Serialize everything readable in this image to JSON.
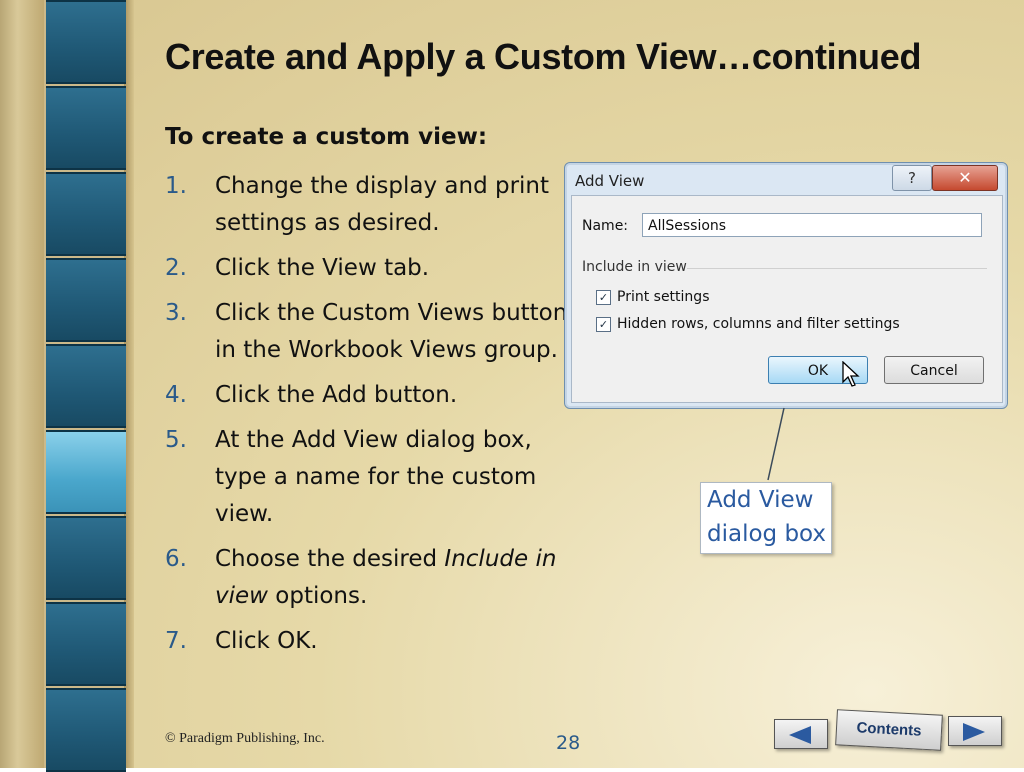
{
  "slide": {
    "title": "Create and Apply a Custom View…continued",
    "subheading": "To create a custom view:",
    "steps": [
      {
        "num": "1.",
        "text": "Change the display and print settings as desired."
      },
      {
        "num": "2.",
        "text": "Click the View tab."
      },
      {
        "num": "3.",
        "text": "Click the Custom Views button in the Workbook Views group."
      },
      {
        "num": "4.",
        "text": "Click the Add button."
      },
      {
        "num": "5.",
        "text": "At the Add View dialog box, type a name for the custom view."
      },
      {
        "num": "6.",
        "text_before": "Choose the desired ",
        "text_italic": "Include in view",
        "text_after": " options."
      },
      {
        "num": "7.",
        "text": "Click OK."
      }
    ],
    "callout": {
      "line1": "Add View",
      "line2": "dialog box"
    },
    "footer": "© Paradigm Publishing, Inc.",
    "page_number": "28",
    "nav": {
      "contents_label": "Contents",
      "prev_icon": "left-arrow-icon",
      "next_icon": "right-arrow-icon"
    }
  },
  "dialog": {
    "title": "Add View",
    "help_glyph": "?",
    "close_glyph": "✕",
    "name_label": "Name:",
    "name_value": "AllSessions",
    "group_label": "Include in view",
    "checkboxes": [
      {
        "label": "Print settings",
        "checked": true
      },
      {
        "label": "Hidden rows, columns and filter settings",
        "checked": true
      }
    ],
    "ok_label": "OK",
    "cancel_label": "Cancel"
  },
  "colors": {
    "accent": "#2a5a8a",
    "callout_text": "#2a5aa0",
    "frame_blue": "#1f5875"
  }
}
